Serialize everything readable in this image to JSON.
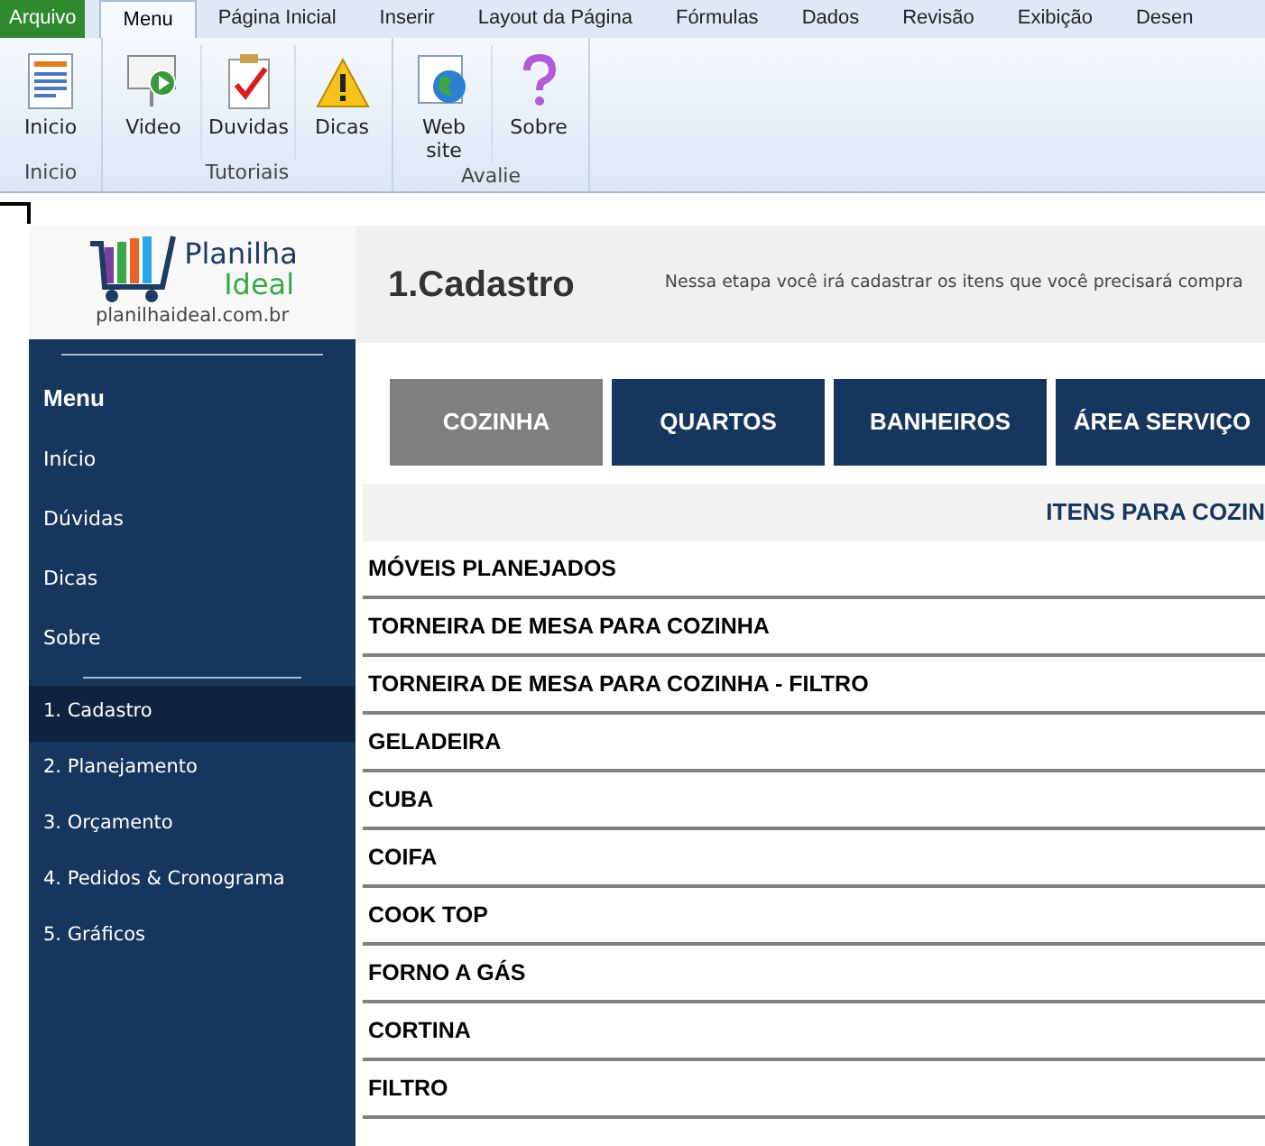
{
  "file_button": {
    "label": "Arquivo"
  },
  "ribbon_tabs": [
    {
      "label": "Menu",
      "selected": true
    },
    {
      "label": "Página Inicial",
      "selected": false
    },
    {
      "label": "Inserir",
      "selected": false
    },
    {
      "label": "Layout da Página",
      "selected": false
    },
    {
      "label": "Fórmulas",
      "selected": false
    },
    {
      "label": "Dados",
      "selected": false
    },
    {
      "label": "Revisão",
      "selected": false
    },
    {
      "label": "Exibição",
      "selected": false
    },
    {
      "label": "Desen",
      "selected": false
    }
  ],
  "ribbon_groups": [
    {
      "label": "Inicio",
      "buttons": [
        {
          "label": "Inicio"
        }
      ]
    },
    {
      "label": "Tutoriais",
      "buttons": [
        {
          "label": "Video"
        },
        {
          "label": "Duvidas"
        },
        {
          "label": "Dicas"
        }
      ]
    },
    {
      "label": "Avalie",
      "buttons": [
        {
          "label": "Web site"
        },
        {
          "label": "Sobre"
        }
      ]
    }
  ],
  "logo": {
    "brand_line1": "Planilha",
    "brand_line2": "Ideal",
    "url": "planilhaideal.com.br"
  },
  "sidebar": {
    "heading": "Menu",
    "sections": [
      {
        "items": [
          {
            "label": "Início",
            "selected": false
          },
          {
            "label": "Dúvidas",
            "selected": false
          },
          {
            "label": "Dicas",
            "selected": false
          },
          {
            "label": "Sobre",
            "selected": false
          }
        ]
      },
      {
        "items": [
          {
            "label": "1. Cadastro",
            "selected": true
          },
          {
            "label": "2. Planejamento",
            "selected": false
          },
          {
            "label": "3. Orçamento",
            "selected": false
          },
          {
            "label": "4. Pedidos & Cronograma",
            "selected": false
          },
          {
            "label": "5. Gráficos",
            "selected": false
          }
        ]
      }
    ]
  },
  "header": {
    "title": "1.Cadastro",
    "description": "Nessa etapa você irá  cadastrar os itens que você  precisará compra"
  },
  "category_tabs": [
    {
      "label": "COZINHA",
      "selected": true
    },
    {
      "label": "QUARTOS",
      "selected": false
    },
    {
      "label": "BANHEIROS",
      "selected": false
    },
    {
      "label": "ÁREA  SERVIÇO",
      "selected": false
    }
  ],
  "table": {
    "heading": "ITENS PARA COZIN",
    "rows": [
      "MÓVEIS PLANEJADOS",
      "TORNEIRA DE MESA PARA COZINHA",
      "TORNEIRA DE MESA PARA COZINHA - FILTRO",
      "GELADEIRA",
      "CUBA",
      "COIFA",
      "COOK TOP",
      "FORNO A GÁS",
      "CORTINA",
      "FILTRO"
    ]
  }
}
